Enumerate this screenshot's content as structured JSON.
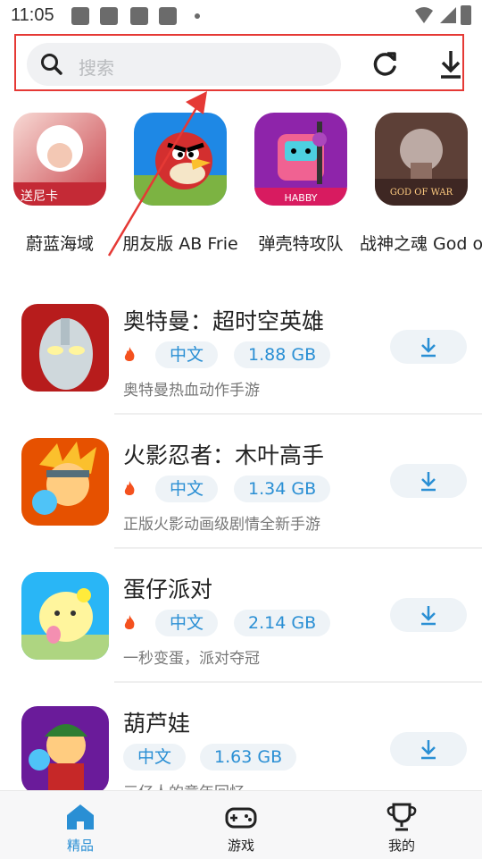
{
  "status_bar": {
    "time": "11:05"
  },
  "search": {
    "placeholder": "搜索"
  },
  "featured": [
    {
      "label": "蔚蓝海域",
      "badge": "送尼卡"
    },
    {
      "label": "朋友版 AB Frie"
    },
    {
      "label": "弹壳特攻队",
      "badge": "HABBY"
    },
    {
      "label": "战神之魂 God of",
      "badge": "GOD OF WAR"
    }
  ],
  "list": [
    {
      "title": "奥特曼：超时空英雄",
      "lang": "中文",
      "size": "1.88 GB",
      "desc": "奥特曼热血动作手游",
      "hot": true
    },
    {
      "title": "火影忍者：木叶高手",
      "lang": "中文",
      "size": "1.34 GB",
      "desc": "正版火影动画级剧情全新手游",
      "hot": true
    },
    {
      "title": "蛋仔派对",
      "lang": "中文",
      "size": "2.14 GB",
      "desc": "一秒变蛋，派对夺冠",
      "hot": true
    },
    {
      "title": "葫芦娃",
      "lang": "中文",
      "size": "1.63 GB",
      "desc": "三亿人的童年回忆",
      "hot": false
    }
  ],
  "nav": [
    {
      "label": "精品",
      "icon": "home-icon",
      "active": true
    },
    {
      "label": "游戏",
      "icon": "gamepad-icon",
      "active": false
    },
    {
      "label": "我的",
      "icon": "trophy-icon",
      "active": false
    }
  ],
  "colors": {
    "accent": "#2a8fd4",
    "highlight_box": "#e53935",
    "tag_bg": "#eef3f7",
    "hot": "#f4511e"
  }
}
